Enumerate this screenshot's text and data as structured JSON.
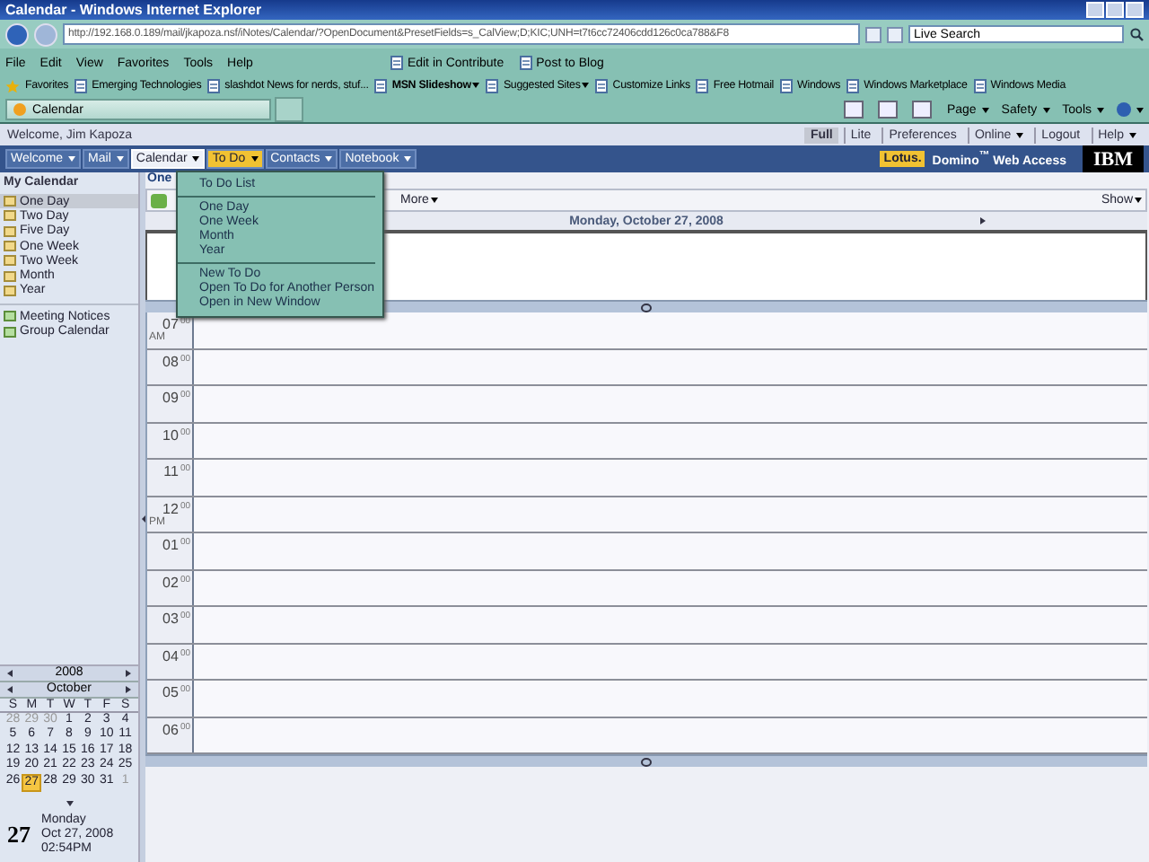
{
  "window": {
    "title": "Calendar - Windows Internet Explorer"
  },
  "address_bar": {
    "url": "http://192.168.0.189/mail/jkapoza.nsf/iNotes/Calendar/?OpenDocument&PresetFields=s_CalView;D;KIC;UNH=t7t6cc72406cdd126c0ca788&F8"
  },
  "search": {
    "placeholder": "Live Search"
  },
  "menu_bar": [
    "File",
    "Edit",
    "View",
    "Favorites",
    "Tools",
    "Help"
  ],
  "command_links": [
    "Edit in Contribute",
    "Post to Blog"
  ],
  "favorites_bar": {
    "label": "Favorites",
    "items": [
      {
        "label": "Emerging Technologies",
        "bold": false,
        "dropdown": false
      },
      {
        "label": "slashdot News for nerds, stuf...",
        "bold": false,
        "dropdown": false
      },
      {
        "label": "MSN Slideshow",
        "bold": true,
        "dropdown": true
      },
      {
        "label": "Suggested Sites",
        "bold": false,
        "dropdown": true
      },
      {
        "label": "Customize Links",
        "bold": false,
        "dropdown": false
      },
      {
        "label": "Free Hotmail",
        "bold": false,
        "dropdown": false
      },
      {
        "label": "Windows",
        "bold": false,
        "dropdown": false
      },
      {
        "label": "Windows Marketplace",
        "bold": false,
        "dropdown": false
      },
      {
        "label": "Windows Media",
        "bold": false,
        "dropdown": false
      }
    ]
  },
  "browser_tab": {
    "title": "Calendar"
  },
  "command_bar": [
    "Page",
    "Safety",
    "Tools"
  ],
  "welcome": "Welcome, Jim Kapoza",
  "view_links": [
    {
      "label": "Full",
      "selected": true,
      "dropdown": false
    },
    {
      "label": "Lite",
      "selected": false,
      "dropdown": false
    },
    {
      "label": "Preferences",
      "selected": false,
      "dropdown": false
    },
    {
      "label": "Online",
      "selected": false,
      "dropdown": true
    },
    {
      "label": "Logout",
      "selected": false,
      "dropdown": false
    },
    {
      "label": "Help",
      "selected": false,
      "dropdown": true
    }
  ],
  "nav_tabs": [
    {
      "label": "Welcome",
      "selected": false,
      "expanded": false
    },
    {
      "label": "Mail",
      "selected": false,
      "expanded": false
    },
    {
      "label": "Calendar",
      "selected": true,
      "expanded": false
    },
    {
      "label": "To Do",
      "selected": false,
      "expanded": true
    },
    {
      "label": "Contacts",
      "selected": false,
      "expanded": false
    },
    {
      "label": "Notebook",
      "selected": false,
      "expanded": false
    }
  ],
  "brand": {
    "lotus": "Lotus.",
    "title": "Domino$^{™}$ Web Access",
    "company": "IBM"
  },
  "todo_menu": {
    "groups": [
      [
        "To Do List"
      ],
      [
        "One Day",
        "One Week",
        "Month",
        "Year"
      ],
      [
        "New To Do",
        "Open To Do for Another Person",
        "Open in New Window"
      ]
    ]
  },
  "sidebar": {
    "heading": "My Calendar",
    "views": [
      {
        "label": "One Day",
        "selected": true
      },
      {
        "label": "Two Day",
        "selected": false
      },
      {
        "label": "Five Day",
        "selected": false
      },
      {
        "label": "One Week",
        "selected": false
      },
      {
        "label": "Two Week",
        "selected": false
      },
      {
        "label": "Month",
        "selected": false
      },
      {
        "label": "Year",
        "selected": false
      }
    ],
    "tools": [
      "Meeting Notices",
      "Group Calendar"
    ]
  },
  "mini_calendar": {
    "year": "2008",
    "month": "October",
    "weekdays": [
      "S",
      "M",
      "T",
      "W",
      "T",
      "F",
      "S"
    ],
    "weeks": [
      [
        {
          "day": "28",
          "outside": true,
          "selected": false
        },
        {
          "day": "29",
          "outside": true,
          "selected": false
        },
        {
          "day": "30",
          "outside": true,
          "selected": false
        },
        {
          "day": "1",
          "outside": false,
          "selected": false
        },
        {
          "day": "2",
          "outside": false,
          "selected": false
        },
        {
          "day": "3",
          "outside": false,
          "selected": false
        },
        {
          "day": "4",
          "outside": false,
          "selected": false
        }
      ],
      [
        {
          "day": "5",
          "outside": false,
          "selected": false
        },
        {
          "day": "6",
          "outside": false,
          "selected": false
        },
        {
          "day": "7",
          "outside": false,
          "selected": false
        },
        {
          "day": "8",
          "outside": false,
          "selected": false
        },
        {
          "day": "9",
          "outside": false,
          "selected": false
        },
        {
          "day": "10",
          "outside": false,
          "selected": false
        },
        {
          "day": "11",
          "outside": false,
          "selected": false
        }
      ],
      [
        {
          "day": "12",
          "outside": false,
          "selected": false
        },
        {
          "day": "13",
          "outside": false,
          "selected": false
        },
        {
          "day": "14",
          "outside": false,
          "selected": false
        },
        {
          "day": "15",
          "outside": false,
          "selected": false
        },
        {
          "day": "16",
          "outside": false,
          "selected": false
        },
        {
          "day": "17",
          "outside": false,
          "selected": false
        },
        {
          "day": "18",
          "outside": false,
          "selected": false
        }
      ],
      [
        {
          "day": "19",
          "outside": false,
          "selected": false
        },
        {
          "day": "20",
          "outside": false,
          "selected": false
        },
        {
          "day": "21",
          "outside": false,
          "selected": false
        },
        {
          "day": "22",
          "outside": false,
          "selected": false
        },
        {
          "day": "23",
          "outside": false,
          "selected": false
        },
        {
          "day": "24",
          "outside": false,
          "selected": false
        },
        {
          "day": "25",
          "outside": false,
          "selected": false
        }
      ],
      [
        {
          "day": "26",
          "outside": false,
          "selected": false
        },
        {
          "day": "27",
          "outside": false,
          "selected": true
        },
        {
          "day": "28",
          "outside": false,
          "selected": false
        },
        {
          "day": "29",
          "outside": false,
          "selected": false
        },
        {
          "day": "30",
          "outside": false,
          "selected": false
        },
        {
          "day": "31",
          "outside": false,
          "selected": false
        },
        {
          "day": "1",
          "outside": true,
          "selected": false
        }
      ]
    ]
  },
  "today": {
    "day": "27",
    "weekday": "Monday",
    "date": "Oct 27, 2008",
    "time": "02:54PM"
  },
  "main": {
    "view_title": "One",
    "more": "More",
    "show": "Show",
    "date_heading": "Monday, October 27, 2008",
    "hours": [
      {
        "hour": "07",
        "minutes": "00",
        "meridiem": "AM"
      },
      {
        "hour": "08",
        "minutes": "00"
      },
      {
        "hour": "09",
        "minutes": "00"
      },
      {
        "hour": "10",
        "minutes": "00"
      },
      {
        "hour": "11",
        "minutes": "00"
      },
      {
        "hour": "12",
        "minutes": "00",
        "meridiem": "PM"
      },
      {
        "hour": "01",
        "minutes": "00"
      },
      {
        "hour": "02",
        "minutes": "00"
      },
      {
        "hour": "03",
        "minutes": "00"
      },
      {
        "hour": "04",
        "minutes": "00"
      },
      {
        "hour": "05",
        "minutes": "00"
      },
      {
        "hour": "06",
        "minutes": "00"
      }
    ]
  }
}
